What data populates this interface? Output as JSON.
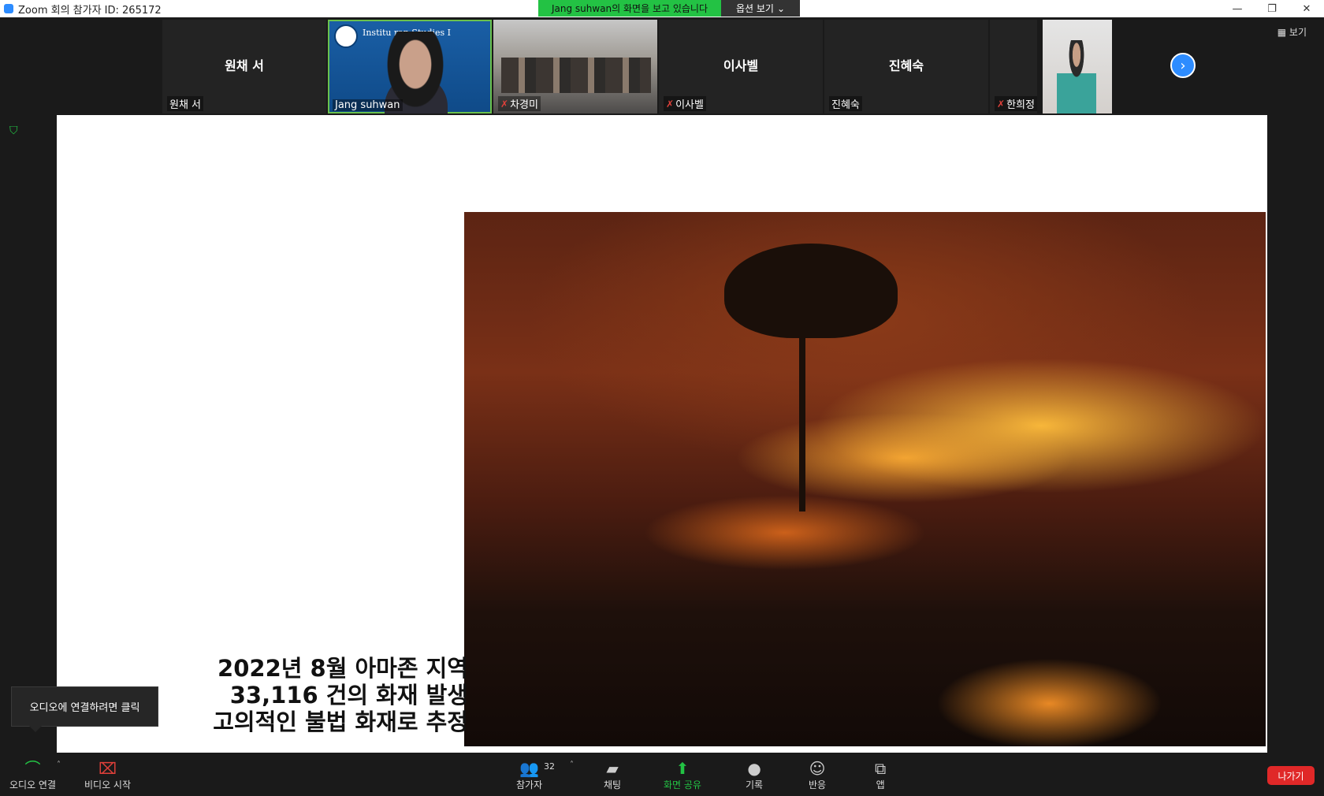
{
  "window": {
    "title": "Zoom 회의 참가자 ID: 265172",
    "min": "—",
    "restore": "❐",
    "close": "✕"
  },
  "share_bar": {
    "status": "Jang suhwan의 화면을 보고 있습니다",
    "options": "옵션 보기",
    "caret": "⌄"
  },
  "view_button": "▦ 보기",
  "participants": [
    {
      "name_big": "원채 서",
      "name": "원채 서"
    },
    {
      "name": "Jang suhwan",
      "logo_text": "Institu      ran Studies I"
    },
    {
      "name": "차경미"
    },
    {
      "name_big": "이사벨",
      "name": "이사벨"
    },
    {
      "name_big": "진혜숙",
      "name": "진혜숙"
    },
    {
      "name": "한희정"
    }
  ],
  "slide": {
    "caption": [
      "2022년 8월 아마존 지역",
      "33,116 건의 화재 발생",
      "고의적인 불법 화재로 추정"
    ]
  },
  "tooltip": "오디오에 연결하려면 클릭",
  "toolbar": {
    "audio": "오디오 연결",
    "video": "비디오 시작",
    "participants": "참가자",
    "participant_count": "32",
    "chat": "채팅",
    "share": "화면 공유",
    "record": "기록",
    "reactions": "반응",
    "apps": "앱",
    "leave": "나가기"
  },
  "colors": {
    "accent": "#2d8cff",
    "share_green": "#23c244",
    "leave_red": "#e02828"
  }
}
